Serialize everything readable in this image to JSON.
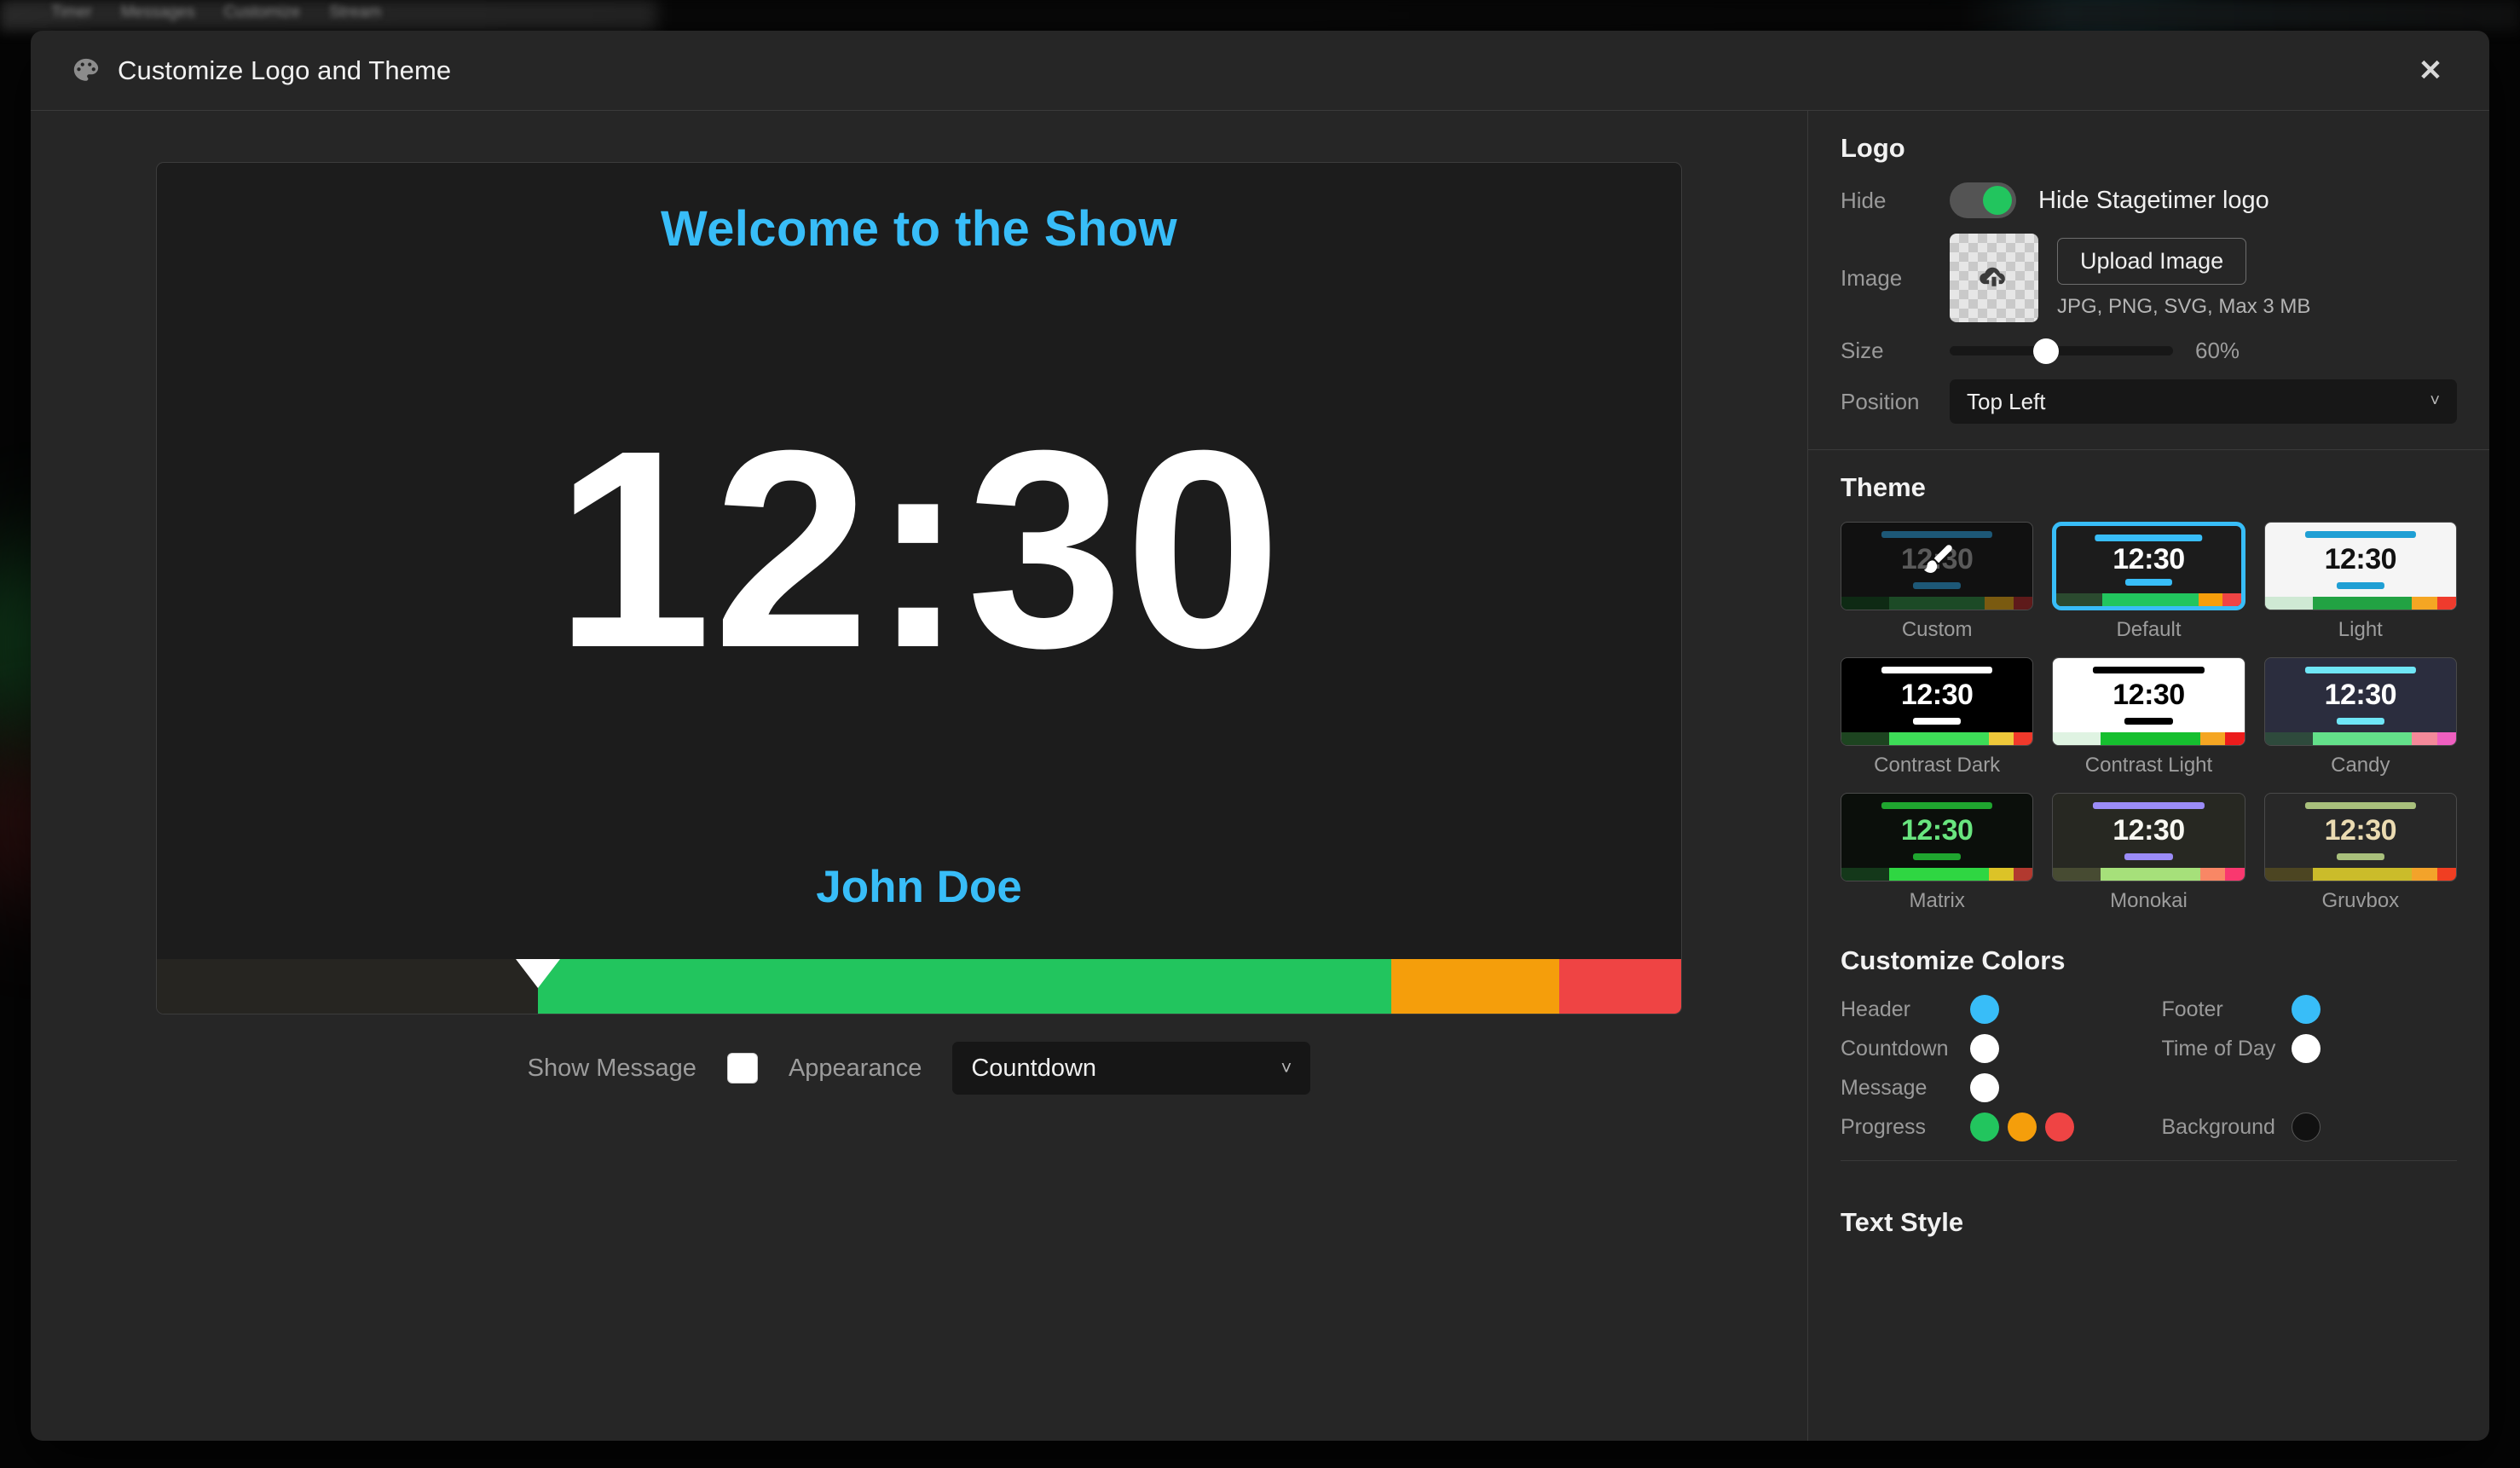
{
  "backdrop": {
    "nav_items": [
      "Timer",
      "Messages",
      "Customize",
      "Stream"
    ]
  },
  "modal": {
    "title": "Customize Logo and Theme",
    "palette_icon": "palette-icon",
    "close_label": "✕"
  },
  "preview": {
    "header_text": "Welcome to the Show",
    "time_text": "12:30",
    "footer_text": "John Doe",
    "header_color": "#38bdf8",
    "footer_color": "#38bdf8",
    "time_color": "#ffffff",
    "background_color": "#1c1c1c",
    "progress": {
      "marker_percent": 25,
      "segments": [
        {
          "name": "elapsed",
          "percent": 25,
          "color": "#262521"
        },
        {
          "name": "normal",
          "percent": 56,
          "color": "#22c55e"
        },
        {
          "name": "warning",
          "percent": 11,
          "color": "#f59e0b"
        },
        {
          "name": "danger",
          "percent": 8,
          "color": "#ef4444"
        }
      ]
    },
    "controls": {
      "show_message_label": "Show Message",
      "show_message_checked": true,
      "appearance_label": "Appearance",
      "appearance_value": "Countdown",
      "chevron_icon": "chevron-down-icon"
    }
  },
  "logo": {
    "section_title": "Logo",
    "hide_label": "Hide",
    "hide_toggle_text": "Hide Stagetimer logo",
    "hide_toggle_on": true,
    "image_label": "Image",
    "upload_icon": "cloud-upload-icon",
    "upload_button": "Upload Image",
    "upload_hint": "JPG, PNG, SVG, Max 3 MB",
    "size_label": "Size",
    "size_value": "60%",
    "size_percent": 43,
    "position_label": "Position",
    "position_value": "Top Left",
    "chevron_icon": "chevron-down-icon"
  },
  "theme": {
    "section_title": "Theme",
    "selected": "Default",
    "items": [
      {
        "label": "Custom",
        "bg": "#111111",
        "time_color": "#5a5a5a",
        "head_color": "#1d5877",
        "foot_color": "#1d5877",
        "time_text": "12:30",
        "has_brush_icon": true,
        "progress": [
          "#0e2a14",
          "#1c4a26",
          "#7a5a10",
          "#5e1a1a"
        ],
        "progress_widths": [
          25,
          50,
          15,
          10
        ]
      },
      {
        "label": "Default",
        "bg": "#1c1c1c",
        "time_color": "#ffffff",
        "head_color": "#38bdf8",
        "foot_color": "#38bdf8",
        "time_text": "12:30",
        "has_brush_icon": false,
        "progress": [
          "#2b4a2f",
          "#22c55e",
          "#f59e0b",
          "#ef4444"
        ],
        "progress_widths": [
          25,
          52,
          13,
          10
        ]
      },
      {
        "label": "Light",
        "bg": "#f5f5f5",
        "time_color": "#111111",
        "head_color": "#1f9fd4",
        "foot_color": "#1f9fd4",
        "time_text": "12:30",
        "has_brush_icon": false,
        "progress": [
          "#cfe9d4",
          "#22a243",
          "#f5a623",
          "#ef3b2d"
        ],
        "progress_widths": [
          25,
          52,
          13,
          10
        ]
      },
      {
        "label": "Contrast Dark",
        "bg": "#000000",
        "time_color": "#ffffff",
        "head_color": "#ffffff",
        "foot_color": "#ffffff",
        "time_text": "12:30",
        "has_brush_icon": false,
        "progress": [
          "#1d4420",
          "#3ddc57",
          "#eec83a",
          "#f0392b"
        ],
        "progress_widths": [
          25,
          52,
          13,
          10
        ]
      },
      {
        "label": "Contrast Light",
        "bg": "#ffffff",
        "time_color": "#000000",
        "head_color": "#000000",
        "foot_color": "#000000",
        "time_text": "12:30",
        "has_brush_icon": false,
        "progress": [
          "#dff3e2",
          "#16bf2f",
          "#f5a623",
          "#ec1c1c"
        ],
        "progress_widths": [
          25,
          52,
          13,
          10
        ]
      },
      {
        "label": "Candy",
        "bg": "#2b2d3e",
        "time_color": "#ffffff",
        "head_color": "#6fe6f7",
        "foot_color": "#6fe6f7",
        "time_text": "12:30",
        "has_brush_icon": false,
        "progress": [
          "#2e4a3c",
          "#63e08a",
          "#f4899a",
          "#ef5fc0"
        ],
        "progress_widths": [
          25,
          52,
          13,
          10
        ]
      },
      {
        "label": "Matrix",
        "bg": "#0b0f0b",
        "time_color": "#69e57f",
        "head_color": "#1fa52f",
        "foot_color": "#1fa52f",
        "time_text": "12:30",
        "has_brush_icon": false,
        "progress": [
          "#14381a",
          "#2fd642",
          "#dcc327",
          "#b2392f"
        ],
        "progress_widths": [
          25,
          52,
          13,
          10
        ]
      },
      {
        "label": "Monokai",
        "bg": "#272822",
        "time_color": "#f8f8f2",
        "head_color": "#9b8cf7",
        "foot_color": "#9b8cf7",
        "time_text": "12:30",
        "has_brush_icon": false,
        "progress": [
          "#474b32",
          "#a6e07a",
          "#f98765",
          "#f9386f"
        ],
        "progress_widths": [
          25,
          52,
          13,
          10
        ]
      },
      {
        "label": "Gruvbox",
        "bg": "#282828",
        "time_color": "#ebdbb2",
        "head_color": "#a9c07c",
        "foot_color": "#a9c07c",
        "time_text": "12:30",
        "has_brush_icon": false,
        "progress": [
          "#4c4522",
          "#cbbc2a",
          "#f3a32a",
          "#f03e22"
        ],
        "progress_widths": [
          25,
          52,
          13,
          10
        ]
      }
    ]
  },
  "colors": {
    "section_title": "Customize Colors",
    "rows": [
      {
        "label": "Header",
        "swatches": [
          "#38bdf8"
        ]
      },
      {
        "label": "Footer",
        "swatches": [
          "#38bdf8"
        ]
      },
      {
        "label": "Countdown",
        "swatches": [
          "#ffffff"
        ]
      },
      {
        "label": "Time of Day",
        "swatches": [
          "#ffffff"
        ]
      },
      {
        "label": "Message",
        "swatches": [
          "#ffffff"
        ]
      },
      {
        "label": "",
        "swatches": []
      },
      {
        "label": "Progress",
        "swatches": [
          "#22c55e",
          "#f59e0b",
          "#ef4444"
        ]
      },
      {
        "label": "Background",
        "swatches": [
          "#111111"
        ]
      }
    ]
  },
  "text_style": {
    "section_title": "Text Style"
  }
}
